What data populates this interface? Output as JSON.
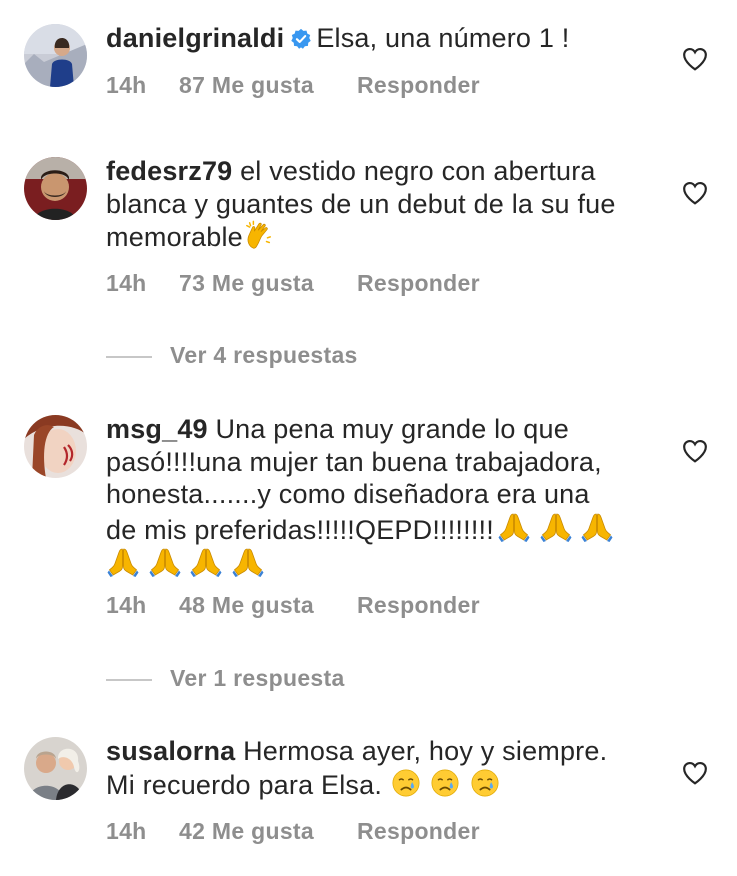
{
  "comments": [
    {
      "username": "danielgrinaldi",
      "verified": true,
      "text": "Elsa, una número 1 !",
      "time": "14h",
      "likes": "87 Me gusta",
      "reply": "Responder"
    },
    {
      "username": "fedesrz79",
      "verified": false,
      "text": "el vestido negro con abertura blanca y guantes de un debut de la su fue memorable",
      "emojis": [
        "clapping-hands"
      ],
      "time": "14h",
      "likes": "73 Me gusta",
      "reply": "Responder",
      "view_replies": "Ver 4 respuestas"
    },
    {
      "username": "msg_49",
      "verified": false,
      "text_line1": "Una pena muy grande lo que",
      "text_line2": "pasó!!!!una mujer tan buena trabajadora,",
      "text_line3": "honesta.......y como diseñadora era una",
      "text_line4": "de mis preferidas!!!!!QEPD!!!!!!!!",
      "emojis": [
        "folded-hands",
        "folded-hands",
        "folded-hands",
        "folded-hands",
        "folded-hands",
        "folded-hands",
        "folded-hands"
      ],
      "time": "14h",
      "likes": "48 Me gusta",
      "reply": "Responder",
      "view_replies": "Ver 1 respuesta"
    },
    {
      "username": "susalorna",
      "verified": false,
      "text_line1": "Hermosa ayer, hoy y siempre.",
      "text_line2": "Mi recuerdo para Elsa.",
      "emojis": [
        "crying-face",
        "crying-face",
        "crying-face"
      ],
      "time": "14h",
      "likes": "42 Me gusta",
      "reply": "Responder"
    }
  ],
  "colors": {
    "text": "#262626",
    "secondary": "#8e8e8e",
    "verified": "#3897f0",
    "divider": "#c7c7c7"
  }
}
